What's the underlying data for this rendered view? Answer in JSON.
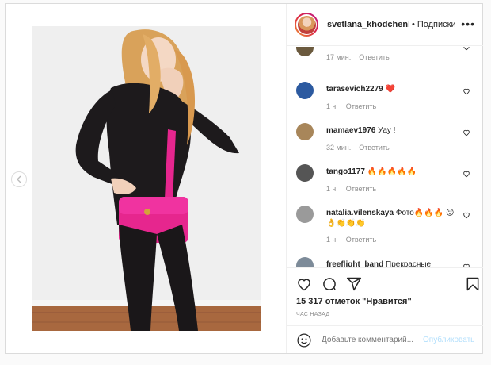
{
  "header": {
    "username": "svetlana_khodchenkova",
    "separator": "•",
    "follow_label": "Подписки",
    "more_icon": "more-options-icon"
  },
  "comments": [
    {
      "user": "",
      "text": "",
      "time": "17 мин.",
      "reply": "Ответить",
      "avatar_color": "#6b5a3e"
    },
    {
      "user": "tarasevich2279",
      "text": "❤️",
      "time": "1 ч.",
      "reply": "Ответить",
      "avatar_color": "#2c5aa0"
    },
    {
      "user": "mamaev1976",
      "text": "Уау !",
      "time": "32 мин.",
      "reply": "Ответить",
      "avatar_color": "#a8865a"
    },
    {
      "user": "tango1177",
      "text": "🔥🔥🔥🔥🔥",
      "time": "1 ч.",
      "reply": "Ответить",
      "avatar_color": "#555555"
    },
    {
      "user": "natalia.vilenskaya",
      "text": "Фото🔥🔥🔥 😜👌👏👏👏",
      "time": "1 ч.",
      "reply": "Ответить",
      "avatar_color": "#9a9a9a"
    },
    {
      "user": "freeflight_band",
      "text": "Прекрасные",
      "time": "",
      "reply": "",
      "avatar_color": "#7d8b99"
    }
  ],
  "actions": {
    "likes_text": "15 317 отметок \"Нравится\"",
    "posted_text": "ЧАС НАЗАД",
    "add_comment_placeholder": "Добавьте комментарий...",
    "publish_label": "Опубликовать"
  },
  "colors": {
    "like_red": "#ed4956",
    "link_blue_disabled": "#b2dffc",
    "meta_gray": "#8e8e8e"
  }
}
